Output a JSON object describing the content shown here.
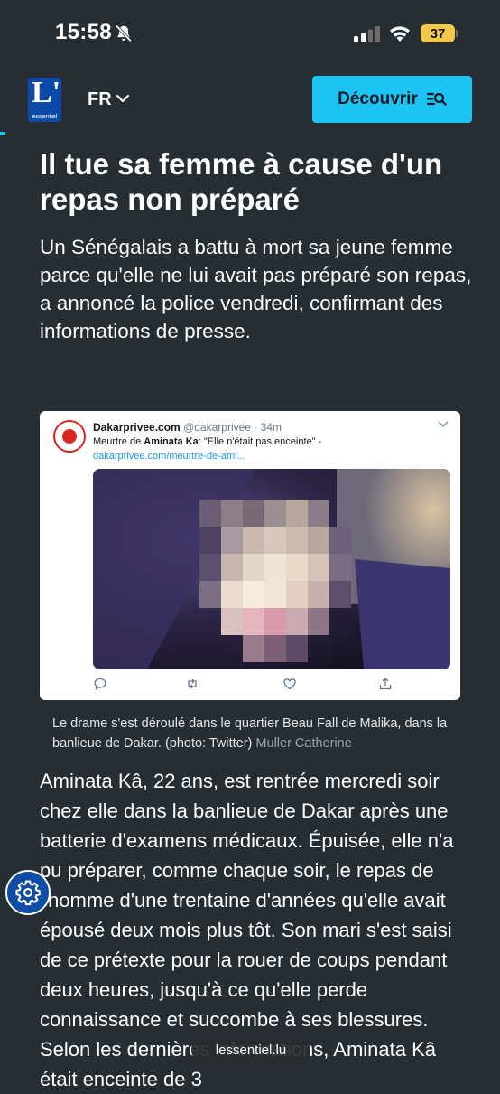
{
  "status_bar": {
    "time": "15:58",
    "battery": "37"
  },
  "header": {
    "logo_letter": "L'",
    "logo_text": "essentiel",
    "language": "FR",
    "discover_label": "Découvrir",
    "accent_color": "#1dc3f2"
  },
  "article": {
    "title": "Il tue sa femme à cause d'un repas non préparé",
    "lead": "Un Sénégalais a battu à mort sa jeune femme parce qu'elle ne lui avait pas préparé son repas, a annoncé la police vendredi, confirmant des informations de presse.",
    "caption": "Le drame s'est déroulé dans le quartier Beau Fall de Malika, dans la banlieue de Dakar. (photo: Twitter)",
    "caption_credit": "Muller Catherine",
    "body": "Aminata Kâ, 22 ans, est rentrée mercredi soir chez elle dans la banlieue de Dakar après une batterie d'examens médicaux. Épuisée, elle n'a pu préparer, comme chaque soir, le repas de l'homme d'une trentaine d'années qu'elle avait épousé deux mois plus tôt. Son mari s'est saisi de ce prétexte pour la rouer de coups pendant deux heures, jusqu'à ce qu'elle perde connaissance et succombe à ses blessures. Selon les dernières informations, Aminata Kâ était enceinte de 3"
  },
  "tweet": {
    "account": "Dakarprivee.com",
    "handle": "@dakarprivee",
    "age": "34m",
    "text_prefix": "Meurtre de ",
    "text_name": "Aminata Ka",
    "text_rest": ": \"Elle n'était pas enceinte\" -",
    "link": "dakarprivee.com/meurtre-de-ami..."
  },
  "browser": {
    "url": "lessentiel.lu"
  },
  "icons": [
    "bell-off-icon",
    "signal-icon",
    "wifi-icon",
    "battery-icon",
    "chevron-down-icon",
    "search-list-icon",
    "settings-icon",
    "reply-icon",
    "retweet-icon",
    "like-icon",
    "share-icon"
  ]
}
